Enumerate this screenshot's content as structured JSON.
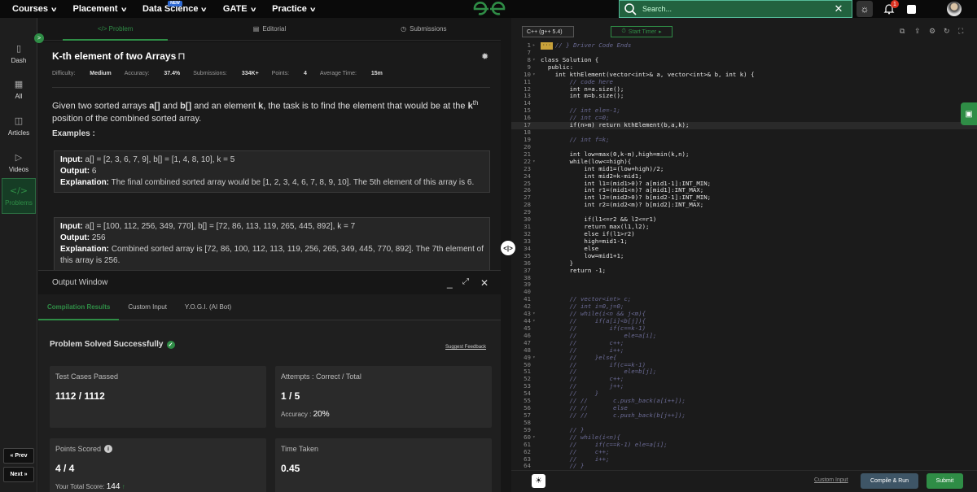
{
  "nav": {
    "items": [
      {
        "label": "Courses"
      },
      {
        "label": "Placement"
      },
      {
        "label": "Data Science",
        "badge": "NEW"
      },
      {
        "label": "GATE"
      },
      {
        "label": "Practice"
      }
    ],
    "search_placeholder": "Search...",
    "notification_count": "1"
  },
  "sidebar": {
    "items": [
      {
        "label": "Dash",
        "icon": "dash-icon"
      },
      {
        "label": "All",
        "icon": "grid-icon"
      },
      {
        "label": "Articles",
        "icon": "book-icon"
      },
      {
        "label": "Videos",
        "icon": "video-icon"
      },
      {
        "label": "Problems",
        "icon": "code-icon"
      }
    ],
    "prev_label": "« Prev",
    "next_label": "Next »"
  },
  "tabs": {
    "problem": "</> Problem",
    "editorial": "Editorial",
    "submissions": "Submissions"
  },
  "problem": {
    "title": "K-th element of two Arrays",
    "difficulty_label": "Difficulty:",
    "difficulty": "Medium",
    "accuracy_label": "Accuracy:",
    "accuracy": "37.4%",
    "submissions_label": "Submissions:",
    "submissions": "334K+",
    "points_label": "Points:",
    "points": "4",
    "avg_time_label": "Average Time:",
    "avg_time": "15m",
    "desc_1": "Given two sorted arrays ",
    "desc_a": "a[]",
    "desc_2": " and ",
    "desc_b": "b[]",
    "desc_3": " and an element ",
    "desc_k": "k",
    "desc_4": ", the task is to find the element that would be at the ",
    "desc_kth": "k",
    "desc_th": "th",
    "desc_5": "position of the combined sorted array.",
    "examples_heading": "Examples :",
    "input_label": "Input:",
    "output_label": "Output:",
    "explanation_label": "Explanation:",
    "examples": [
      {
        "input": "a[] = [2, 3, 6, 7, 9], b[] = [1, 4, 8, 10], k = 5",
        "output": "6",
        "explanation": "The final combined sorted array would be [1, 2, 3, 4, 6, 7, 8, 9, 10]. The 5th element of this array is 6."
      },
      {
        "input": "a[] = [100, 112, 256, 349, 770], b[] = [72, 86, 113, 119, 265, 445, 892], k = 7",
        "output": "256",
        "explanation": "Combined sorted array is [72, 86, 100, 112, 113, 119, 256, 265, 349, 445, 770, 892]. The 7th element of this array is 256."
      }
    ]
  },
  "output_window": {
    "title": "Output Window",
    "tabs": [
      "Compilation Results",
      "Custom Input",
      "Y.O.G.I. (AI Bot)"
    ],
    "status": "Problem Solved Successfully",
    "suggest_feedback": "Suggest Feedback",
    "test_cases_label": "Test Cases Passed",
    "test_cases": "1112 / 1112",
    "attempts_label": "Attempts : Correct / Total",
    "attempts": "1 / 5",
    "accuracy_label": "Accuracy :",
    "accuracy": "20%",
    "points_label": "Points Scored",
    "points": "4 / 4",
    "total_score_label": "Your Total Score:",
    "total_score": "144",
    "time_label": "Time Taken",
    "time": "0.45"
  },
  "editor": {
    "language": "C++ (g++ 5.4)",
    "timer_label": "Start Timer",
    "custom_input": "Custom Input",
    "compile_run": "Compile & Run",
    "submit": "Submit",
    "lines": [
      {
        "n": "1",
        "fold": "▸",
        "text": "// } Driver Code Ends",
        "cls": "cm",
        "tag": "···"
      },
      {
        "n": "7",
        "fold": "",
        "text": "",
        "cls": "ct"
      },
      {
        "n": "8",
        "fold": "▾",
        "text": "class Solution {",
        "cls": "ct"
      },
      {
        "n": "9",
        "fold": "",
        "text": "  public:",
        "cls": "ct"
      },
      {
        "n": "10",
        "fold": "▾",
        "text": "    int kthElement(vector<int>& a, vector<int>& b, int k) {",
        "cls": "ct"
      },
      {
        "n": "11",
        "fold": "",
        "text": "        // code here",
        "cls": "cm"
      },
      {
        "n": "12",
        "fold": "",
        "text": "        int n=a.size();",
        "cls": "ct"
      },
      {
        "n": "13",
        "fold": "",
        "text": "        int m=b.size();",
        "cls": "ct"
      },
      {
        "n": "14",
        "fold": "",
        "text": "",
        "cls": "ct"
      },
      {
        "n": "15",
        "fold": "",
        "text": "        // int ele=-1;",
        "cls": "cm"
      },
      {
        "n": "16",
        "fold": "",
        "text": "        // int c=0;",
        "cls": "cm"
      },
      {
        "n": "17",
        "fold": "",
        "text": "        if(n>m) return kthElement(b,a,k);",
        "cls": "ct",
        "hl": true
      },
      {
        "n": "18",
        "fold": "",
        "text": "",
        "cls": "ct"
      },
      {
        "n": "19",
        "fold": "",
        "text": "        // int f=k;",
        "cls": "cm"
      },
      {
        "n": "20",
        "fold": "",
        "text": "",
        "cls": "ct"
      },
      {
        "n": "21",
        "fold": "",
        "text": "        int low=max(0,k-m),high=min(k,n);",
        "cls": "ct"
      },
      {
        "n": "22",
        "fold": "▾",
        "text": "        while(low<=high){",
        "cls": "ct"
      },
      {
        "n": "23",
        "fold": "",
        "text": "            int mid1=(low+high)/2;",
        "cls": "ct"
      },
      {
        "n": "24",
        "fold": "",
        "text": "            int mid2=k-mid1;",
        "cls": "ct"
      },
      {
        "n": "25",
        "fold": "",
        "text": "            int l1=(mid1>0)? a[mid1-1]:INT_MIN;",
        "cls": "ct"
      },
      {
        "n": "26",
        "fold": "",
        "text": "            int r1=(mid1<n)? a[mid1]:INT_MAX;",
        "cls": "ct"
      },
      {
        "n": "27",
        "fold": "",
        "text": "            int l2=(mid2>0)? b[mid2-1]:INT_MIN;",
        "cls": "ct"
      },
      {
        "n": "28",
        "fold": "",
        "text": "            int r2=(mid2<m)? b[mid2]:INT_MAX;",
        "cls": "ct"
      },
      {
        "n": "29",
        "fold": "",
        "text": "",
        "cls": "ct"
      },
      {
        "n": "30",
        "fold": "",
        "text": "            if(l1<=r2 && l2<=r1)",
        "cls": "ct"
      },
      {
        "n": "31",
        "fold": "",
        "text": "            return max(l1,l2);",
        "cls": "ct"
      },
      {
        "n": "32",
        "fold": "",
        "text": "            else if(l1>r2)",
        "cls": "ct"
      },
      {
        "n": "33",
        "fold": "",
        "text": "            high=mid1-1;",
        "cls": "ct"
      },
      {
        "n": "34",
        "fold": "",
        "text": "            else",
        "cls": "ct"
      },
      {
        "n": "35",
        "fold": "",
        "text": "            low=mid1+1;",
        "cls": "ct"
      },
      {
        "n": "36",
        "fold": "",
        "text": "        }",
        "cls": "ct"
      },
      {
        "n": "37",
        "fold": "",
        "text": "        return -1;",
        "cls": "ct"
      },
      {
        "n": "38",
        "fold": "",
        "text": "",
        "cls": "ct"
      },
      {
        "n": "39",
        "fold": "",
        "text": "",
        "cls": "ct"
      },
      {
        "n": "40",
        "fold": "",
        "text": "",
        "cls": "ct"
      },
      {
        "n": "41",
        "fold": "",
        "text": "        // vector<int> c;",
        "cls": "cm"
      },
      {
        "n": "42",
        "fold": "",
        "text": "        // int i=0,j=0;",
        "cls": "cm"
      },
      {
        "n": "43",
        "fold": "▾",
        "text": "        // while(i<n && j<m){",
        "cls": "cm"
      },
      {
        "n": "44",
        "fold": "▾",
        "text": "        //     if(a[i]<b[j]){",
        "cls": "cm"
      },
      {
        "n": "45",
        "fold": "",
        "text": "        //         if(c==k-1)",
        "cls": "cm"
      },
      {
        "n": "46",
        "fold": "",
        "text": "        //             ele=a[i];",
        "cls": "cm"
      },
      {
        "n": "47",
        "fold": "",
        "text": "        //         c++;",
        "cls": "cm"
      },
      {
        "n": "48",
        "fold": "",
        "text": "        //         i++;",
        "cls": "cm"
      },
      {
        "n": "49",
        "fold": "▾",
        "text": "        //     }else{",
        "cls": "cm"
      },
      {
        "n": "50",
        "fold": "",
        "text": "        //         if(c==k-1)",
        "cls": "cm"
      },
      {
        "n": "51",
        "fold": "",
        "text": "        //             ele=b[j];",
        "cls": "cm"
      },
      {
        "n": "52",
        "fold": "",
        "text": "        //         c++;",
        "cls": "cm"
      },
      {
        "n": "53",
        "fold": "",
        "text": "        //         j++;",
        "cls": "cm"
      },
      {
        "n": "54",
        "fold": "",
        "text": "        //     }",
        "cls": "cm"
      },
      {
        "n": "55",
        "fold": "",
        "text": "        // //       c.push_back(a[i++]);",
        "cls": "cm"
      },
      {
        "n": "56",
        "fold": "",
        "text": "        // //       else",
        "cls": "cm"
      },
      {
        "n": "57",
        "fold": "",
        "text": "        // //       c.push_back(b[j++]);",
        "cls": "cm"
      },
      {
        "n": "58",
        "fold": "",
        "text": "",
        "cls": "ct"
      },
      {
        "n": "59",
        "fold": "",
        "text": "        // }",
        "cls": "cm"
      },
      {
        "n": "60",
        "fold": "▾",
        "text": "        // while(i<n){",
        "cls": "cm"
      },
      {
        "n": "61",
        "fold": "",
        "text": "        //     if(c==k-1) ele=a[i];",
        "cls": "cm"
      },
      {
        "n": "62",
        "fold": "",
        "text": "        //     c++;",
        "cls": "cm"
      },
      {
        "n": "63",
        "fold": "",
        "text": "        //     i++;",
        "cls": "cm"
      },
      {
        "n": "64",
        "fold": "",
        "text": "        // }",
        "cls": "cm"
      }
    ]
  }
}
